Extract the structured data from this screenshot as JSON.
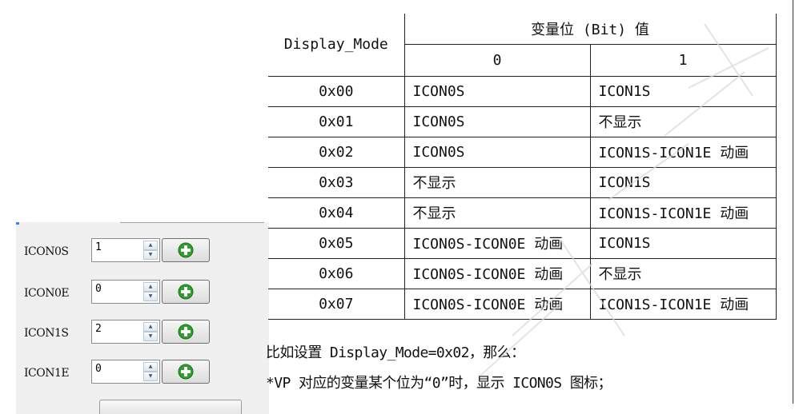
{
  "panel": {
    "rows": [
      {
        "label": "ICON0S",
        "value": "1"
      },
      {
        "label": "ICON0E",
        "value": "0"
      },
      {
        "label": "ICON1S",
        "value": "2"
      },
      {
        "label": "ICON1E",
        "value": "0"
      }
    ]
  },
  "table": {
    "header_mode": "Display_Mode",
    "header_bits": "变量位 (Bit) 值",
    "bit0": "0",
    "bit1": "1",
    "rows": [
      {
        "mode": "0x00",
        "b0": "ICON0S",
        "b1": "ICON1S"
      },
      {
        "mode": "0x01",
        "b0": "ICON0S",
        "b1": "不显示"
      },
      {
        "mode": "0x02",
        "b0": "ICON0S",
        "b1": "ICON1S-ICON1E 动画"
      },
      {
        "mode": "0x03",
        "b0": "不显示",
        "b1": "ICON1S"
      },
      {
        "mode": "0x04",
        "b0": "不显示",
        "b1": "ICON1S-ICON1E 动画"
      },
      {
        "mode": "0x05",
        "b0": "ICON0S-ICON0E 动画",
        "b1": "ICON1S"
      },
      {
        "mode": "0x06",
        "b0": "ICON0S-ICON0E 动画",
        "b1": "不显示"
      },
      {
        "mode": "0x07",
        "b0": "ICON0S-ICON0E 动画",
        "b1": "ICON1S-ICON1E 动画"
      }
    ]
  },
  "notes": {
    "line1": "比如设置 Display_Mode=0x02，那么：",
    "line2": "*VP 对应的变量某个位为“0”时，显示 ICON0S 图标；"
  },
  "colors": {
    "add_icon_green": "#2f9e2f",
    "panel_bg": "#f0f0f0"
  }
}
